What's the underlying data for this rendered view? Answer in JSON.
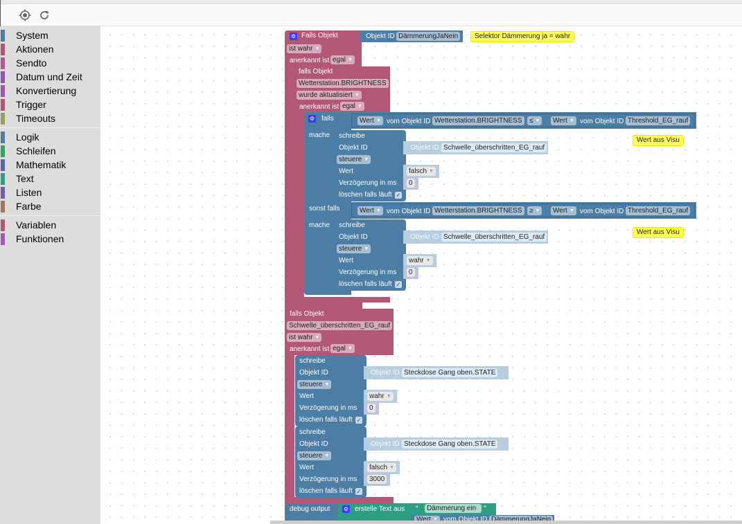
{
  "toolbar": {
    "buttons": [
      {
        "name": "center-button",
        "icon": "crosshair-icon"
      },
      {
        "name": "refresh-button",
        "icon": "refresh-icon"
      }
    ]
  },
  "toolbox": {
    "groups": [
      [
        {
          "label": "System",
          "color": "#4c7da5"
        },
        {
          "label": "Aktionen",
          "color": "#b35777"
        },
        {
          "label": "Sendto",
          "color": "#b35797"
        },
        {
          "label": "Datum und Zeit",
          "color": "#8e57b3"
        },
        {
          "label": "Konvertierung",
          "color": "#9d57b3"
        },
        {
          "label": "Trigger",
          "color": "#b35777"
        },
        {
          "label": "Timeouts",
          "color": "#99a05a"
        }
      ],
      [
        {
          "label": "Logik",
          "color": "#4c7da5"
        },
        {
          "label": "Schleifen",
          "color": "#3aa35a"
        },
        {
          "label": "Mathematik",
          "color": "#5b67a5"
        },
        {
          "label": "Text",
          "color": "#2d9e84"
        },
        {
          "label": "Listen",
          "color": "#7a57b3"
        },
        {
          "label": "Farbe",
          "color": "#a5745b"
        }
      ],
      [
        {
          "label": "Variablen",
          "color": "#b35777"
        },
        {
          "label": "Funktionen",
          "color": "#a557b3"
        }
      ]
    ]
  },
  "blocks": {
    "trigger1": {
      "title": "Falls Objekt",
      "object_id_label": "Objekt ID",
      "object_id": "DämmerungJaNein",
      "condition": "ist wahr",
      "ack_label": "anerkannt ist",
      "ack_value": "egal",
      "comment": "Selektor Dämmerung ja = wahr"
    },
    "trigger2": {
      "title": "falls Objekt",
      "object": "Wetterstation.BRIGHTNESS",
      "condition": "wurde aktualisiert",
      "ack_label": "anerkannt ist",
      "ack_value": "egal"
    },
    "if_block": {
      "if_label": "falls",
      "do_label": "mache",
      "elseif_label": "sonst falls",
      "cond1": {
        "left_prop": "Wert",
        "left_label": "vom Objekt ID",
        "left_obj": "Wetterstation.BRIGHTNESS",
        "op": "≤",
        "right_prop": "Wert",
        "right_label": "vom Objekt ID",
        "right_obj": "Threshold_EG_rauf"
      },
      "cond2": {
        "left_prop": "Wert",
        "left_label": "vom Objekt ID",
        "left_obj": "Wetterstation.BRIGHTNESS",
        "op": "≥",
        "right_prop": "Wert",
        "right_label": "vom Objekt ID",
        "right_obj": "Threshold_EG_rauf"
      },
      "write1": {
        "title": "schreibe",
        "obj_label": "Objekt ID",
        "obj_inner_label": "Objekt ID",
        "obj": "Schwelle_überschritten_EG_rauf",
        "mode": "steuere",
        "value_label": "Wert",
        "value": "falsch",
        "delay_label": "Verzögerung in ms",
        "delay": "0",
        "clear_label": "löschen falls läuft",
        "clear_checked": true
      },
      "write2": {
        "title": "schreibe",
        "obj_label": "Objekt ID",
        "obj_inner_label": "Objekt ID",
        "obj": "Schwelle_überschritten_EG_rauf",
        "mode": "steuere",
        "value_label": "Wert",
        "value": "wahr",
        "delay_label": "Verzögerung in ms",
        "delay": "0",
        "clear_label": "löschen falls läuft",
        "clear_checked": true
      },
      "comment1": "Wert aus Visu",
      "comment2": "Wert aus Visu"
    },
    "trigger3": {
      "title": "falls Objekt",
      "object": "Schwelle_überschritten_EG_rauf",
      "condition": "ist wahr",
      "ack_label": "anerkannt ist",
      "ack_value": "egal",
      "write1": {
        "title": "schreibe",
        "obj_label": "Objekt ID",
        "obj_inner_label": "Objekt ID",
        "obj": "Steckdose Gang oben.STATE",
        "mode": "steuere",
        "value_label": "Wert",
        "value": "wahr",
        "delay_label": "Verzögerung in ms",
        "delay": "0",
        "clear_label": "löschen falls läuft",
        "clear_checked": true
      },
      "write2": {
        "title": "schreibe",
        "obj_label": "Objekt ID",
        "obj_inner_label": "Objekt ID",
        "obj": "Steckdose Gang oben.STATE",
        "mode": "steuere",
        "value_label": "Wert",
        "value": "falsch",
        "delay_label": "Verzögerung in ms",
        "delay": "3000",
        "clear_label": "löschen falls läuft",
        "clear_checked": true
      }
    },
    "debug": {
      "label": "debug output",
      "join_label": "erstelle Text aus",
      "text": "Dämmerung ein",
      "open_quote": "“",
      "close_quote": "”",
      "prop": "Wert",
      "obj_label": "vom Objekt ID",
      "obj": "DämmerungJaNein"
    }
  },
  "symbols": {
    "dropdown": "▼",
    "check": "✓",
    "gear": "⚙"
  }
}
